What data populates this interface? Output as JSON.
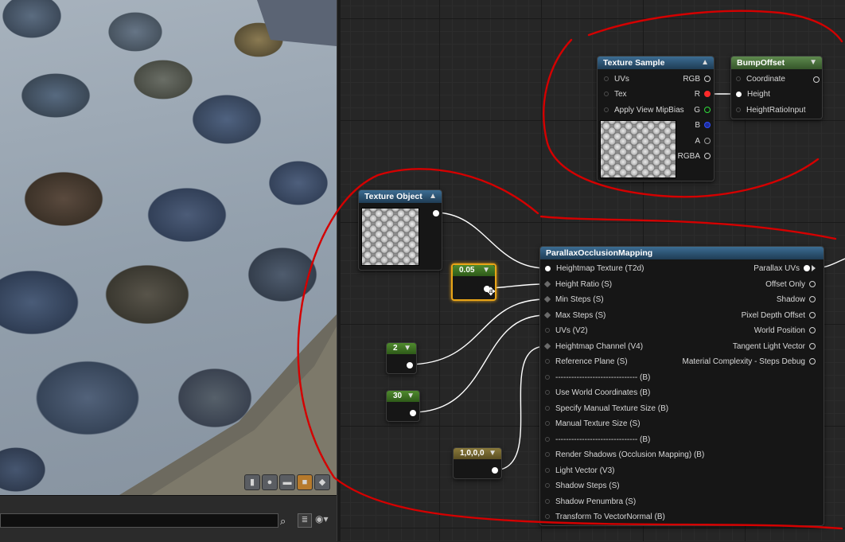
{
  "viewport": {
    "toolbar_icons": [
      "cylinder-icon",
      "sphere-icon",
      "plane-icon",
      "cube-icon",
      "teapot-icon"
    ],
    "active_icon": "cube-icon"
  },
  "search": {
    "value": "",
    "placeholder": ""
  },
  "nodes": {
    "texture_sample": {
      "title": "Texture Sample",
      "inputs": [
        "UVs",
        "Tex",
        "Apply View MipBias"
      ],
      "outputs": [
        "RGB",
        "R",
        "G",
        "B",
        "A",
        "RGBA"
      ]
    },
    "bump_offset": {
      "title": "BumpOffset",
      "inputs": [
        "Coordinate",
        "Height",
        "HeightRatioInput"
      ]
    },
    "texture_object": {
      "title": "Texture Object"
    },
    "const_height_ratio": {
      "value": "0.05"
    },
    "const_min_steps": {
      "value": "2"
    },
    "const_max_steps": {
      "value": "30"
    },
    "const_channel": {
      "value": "1,0,0,0"
    },
    "pom": {
      "title": "ParallaxOcclusionMapping",
      "inputs": [
        "Heightmap Texture (T2d)",
        "Height Ratio (S)",
        "Min Steps (S)",
        "Max Steps (S)",
        "UVs (V2)",
        "Heightmap Channel (V4)",
        "Reference Plane (S)",
        "------------------------------- (B)",
        "Use World Coordinates (B)",
        "Specify Manual Texture Size (B)",
        "Manual Texture Size (S)",
        "------------------------------- (B)",
        "Render Shadows (Occlusion Mapping) (B)",
        "Light Vector (V3)",
        "Shadow Steps (S)",
        "Shadow Penumbra (S)",
        "Transform To VectorNormal (B)"
      ],
      "outputs": [
        "Parallax UVs",
        "Offset Only",
        "Shadow",
        "Pixel Depth Offset",
        "World Position",
        "Tangent Light Vector",
        "Material Complexity - Steps Debug"
      ]
    }
  },
  "colors": {
    "annotation": "#d40000",
    "selection": "#e8a417",
    "pin_red": "#ff2a2a",
    "pin_green": "#2fdc3a",
    "pin_blue": "#2f4fff"
  }
}
